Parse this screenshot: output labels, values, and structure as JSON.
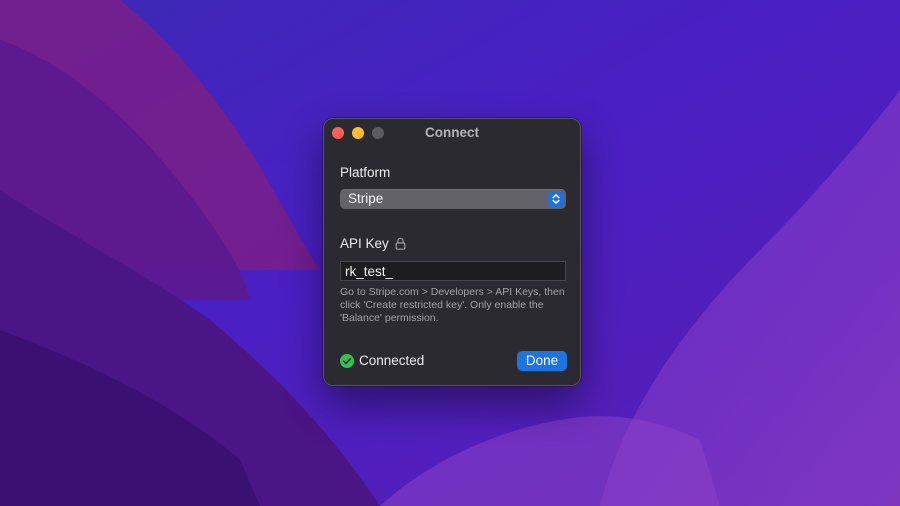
{
  "window": {
    "title": "Connect"
  },
  "form": {
    "platform_label": "Platform",
    "platform_value": "Stripe",
    "api_key_label": "API Key",
    "api_key_value": "rk_test_",
    "help_text": "Go to Stripe.com > Developers > API Keys, then click 'Create restricted key'. Only enable the 'Balance' permission."
  },
  "footer": {
    "status_text": "Connected",
    "done_label": "Done"
  },
  "icons": {
    "lock": "lock-icon",
    "status": "checkmark-circle-icon",
    "stepper": "chevron-up-down-icon"
  },
  "colors": {
    "accent": "#1c74e0",
    "status_ok": "#30c252",
    "close": "#fe5f57",
    "minimize": "#febc2e"
  }
}
